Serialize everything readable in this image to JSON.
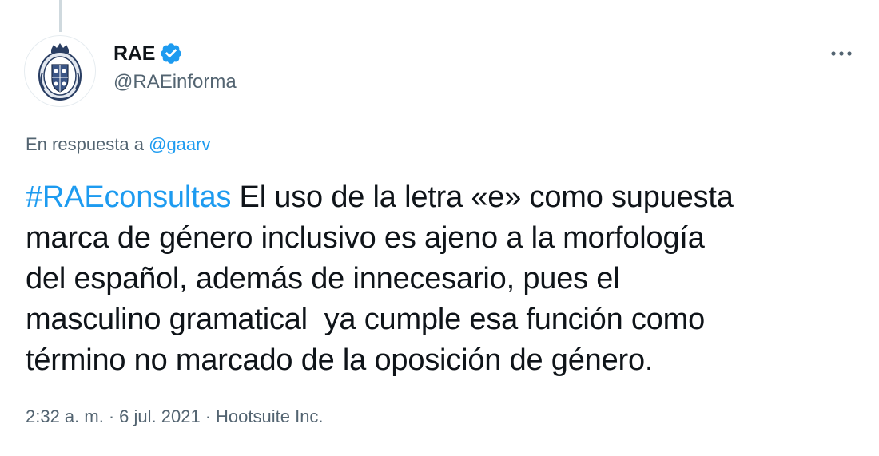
{
  "author": {
    "display_name": "RAE",
    "handle": "@RAEinforma",
    "avatar_icon": "royal-academy-crest-icon",
    "verified_icon": "verified-badge-icon"
  },
  "more_icon": "more-options-icon",
  "reply": {
    "prefix": "En respuesta a ",
    "mention": "@gaarv"
  },
  "tweet": {
    "hashtag": "#RAEconsultas",
    "line1_rest": " El uso de la letra «e» como supuesta",
    "line2": "marca de género inclusivo es ajeno a la morfología",
    "line3": "del español, además de innecesario, pues el",
    "line4": "masculino gramatical  ya cumple esa función como",
    "line5": "término no marcado de la oposición de género."
  },
  "meta": {
    "time": "2:32 a. m.",
    "separator": "·",
    "date": "6 jul. 2021",
    "source": "Hootsuite Inc."
  },
  "colors": {
    "link_blue": "#1d9bf0",
    "text_primary": "#0f1419",
    "text_secondary": "#536471"
  }
}
